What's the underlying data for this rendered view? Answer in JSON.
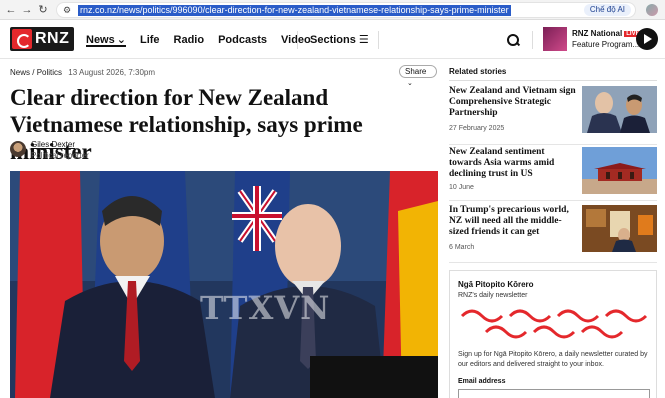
{
  "browser": {
    "url": "rnz.co.nz/news/politics/996090/clear-direction-for-new-zealand-vietnamese-relationship-says-prime-minister",
    "ai_mode_label": "Chế độ AI"
  },
  "header": {
    "logo_text": "RNZ",
    "nav": [
      "News",
      "Life",
      "Radio",
      "Podcasts",
      "Video"
    ],
    "sections_label": "Sections",
    "live": {
      "station": "RNZ National",
      "badge": "LIVE",
      "program": "Feature Program..."
    }
  },
  "article": {
    "breadcrumb_news": "News",
    "breadcrumb_sep": "/",
    "breadcrumb_section": "Politics",
    "date": "13 August 2026, 7:30pm",
    "share_label": "Share",
    "headline": "Clear direction for New Zealand Vietnamese relationship, says prime minister",
    "author": "Giles Dexter",
    "role": "Political reporter",
    "watermark": "TTXVN"
  },
  "sidebar": {
    "heading": "Related stories",
    "stories": [
      {
        "title": "New Zealand and Vietnam sign Comprehensive Strategic Partnership",
        "date": "27 February 2025"
      },
      {
        "title": "New Zealand sentiment towards Asia warms amid declining trust in US",
        "date": "10 June"
      },
      {
        "title": "In Trump's precarious world, NZ will need all the middle-sized friends it can get",
        "date": "6 March"
      }
    ]
  },
  "newsletter": {
    "title": "Ngā Pitopito Kōrero",
    "subtitle": "RNZ's daily newsletter",
    "description": "Sign up for Ngā Pitopito Kōrero, a daily newsletter curated by our editors and delivered straight to your inbox.",
    "email_label": "Email address"
  },
  "colors": {
    "brand_red": "#e4282c",
    "link_highlight": "#2a5cc8"
  }
}
